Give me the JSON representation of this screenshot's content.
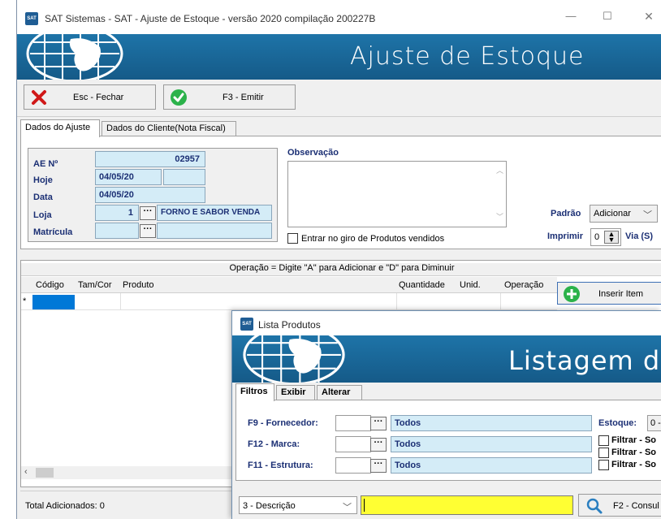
{
  "window": {
    "title": "SAT Sistemas - SAT - Ajuste de Estoque - versão 2020 compilação 200227B",
    "icon_text": "SAT",
    "controls": {
      "minimize": "—",
      "maximize": "☐",
      "close": "✕"
    }
  },
  "banner": {
    "title": "Ajuste de Estoque"
  },
  "toolbar": {
    "close_label": "Esc - Fechar",
    "emit_label": "F3 - Emitir"
  },
  "tabs": [
    "Dados do Ajuste",
    "Dados do Cliente(Nota Fiscal)"
  ],
  "form": {
    "ae_label": "AE Nº",
    "ae_value": "02957",
    "hoje_label": "Hoje",
    "hoje_value": "04/05/20",
    "hoje_extra": "",
    "data_label": "Data",
    "data_value": "04/05/20",
    "loja_label": "Loja",
    "loja_value": "1",
    "loja_name": "FORNO E SABOR VENDA",
    "matricula_label": "Matrícula",
    "matricula_value": "",
    "matricula_name": "",
    "ellipsis": "···"
  },
  "observacao": {
    "label": "Observação",
    "value": "",
    "checkbox_label": "Entrar no giro de Produtos vendidos",
    "checkbox_checked": false
  },
  "right_panel": {
    "padrao_label": "Padrão",
    "padrao_value": "Adicionar",
    "imprimir_label": "Imprimir",
    "imprimir_value": "0",
    "via_label": "Via (S)"
  },
  "grid": {
    "instruction": "Operação = Digite \"A\" para Adicionar e \"D\" para Diminuir",
    "columns": [
      "Código",
      "Tam/Cor",
      "Produto",
      "Quantidade",
      "Unid.",
      "Operação"
    ],
    "row_marker": "*",
    "insert_button": "Inserir Item"
  },
  "status": {
    "total_added": "Total Adicionados: 0"
  },
  "dialog": {
    "title": "Lista Produtos",
    "icon_text": "SAT",
    "banner_title": "Listagem de I",
    "tabs": [
      "Filtros",
      "Exibir",
      "Alterar"
    ],
    "filters": [
      {
        "label": "F9 - Fornecedor:",
        "code": "",
        "value": "Todos"
      },
      {
        "label": "F12 - Marca:",
        "code": "",
        "value": "Todos"
      },
      {
        "label": "F11 - Estrutura:",
        "code": "",
        "value": "Todos"
      }
    ],
    "estoque_label": "Estoque:",
    "estoque_value": "0 -",
    "checkboxes": [
      "Filtrar - So",
      "Filtrar - So",
      "Filtrar - So"
    ],
    "search_type": "3 - Descrição",
    "search_value": "",
    "consult_label": "F2 - Consul"
  },
  "colors": {
    "banner_blue": "#1a6a9e",
    "field_blue": "#d4ecf7",
    "label_blue": "#1b2f74",
    "search_yellow": "#ffff33"
  }
}
